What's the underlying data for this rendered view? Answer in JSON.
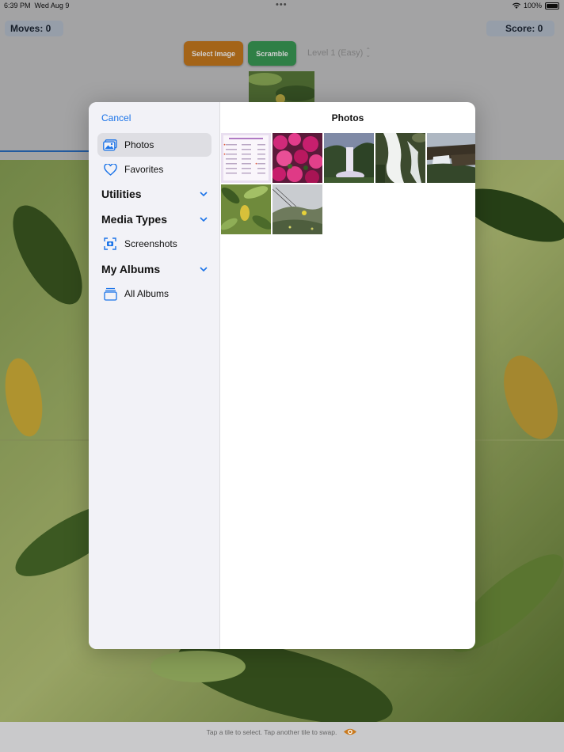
{
  "status": {
    "time": "6:39 PM",
    "date": "Wed Aug 9",
    "battery": "100%"
  },
  "game": {
    "moves_label": "Moves: 0",
    "score_label": "Score: 0",
    "select_image": "Select Image",
    "scramble": "Scramble",
    "level": "Level 1 (Easy)",
    "hint": "Tap a tile to select. Tap another tile to swap."
  },
  "picker": {
    "cancel": "Cancel",
    "title": "Photos",
    "items": [
      {
        "label": "Photos",
        "icon": "photos-icon"
      },
      {
        "label": "Favorites",
        "icon": "heart-icon"
      },
      {
        "label": "Screenshots",
        "icon": "screenshot-icon"
      },
      {
        "label": "All Albums",
        "icon": "albums-icon"
      }
    ],
    "sections": [
      {
        "label": "Utilities"
      },
      {
        "label": "Media Types"
      },
      {
        "label": "My Albums"
      }
    ],
    "thumbnails": [
      {
        "name": "document-thumbnail"
      },
      {
        "name": "pink-flowers-thumbnail"
      },
      {
        "name": "waterfall-thumbnail"
      },
      {
        "name": "cascade-thumbnail"
      },
      {
        "name": "cliff-waterfall-thumbnail"
      },
      {
        "name": "leaves-thumbnail"
      },
      {
        "name": "hillside-thumbnail"
      }
    ]
  },
  "colors": {
    "accent": "#1a73e8",
    "select_button": "#c97a1e",
    "scramble_button": "#3a9b56"
  }
}
